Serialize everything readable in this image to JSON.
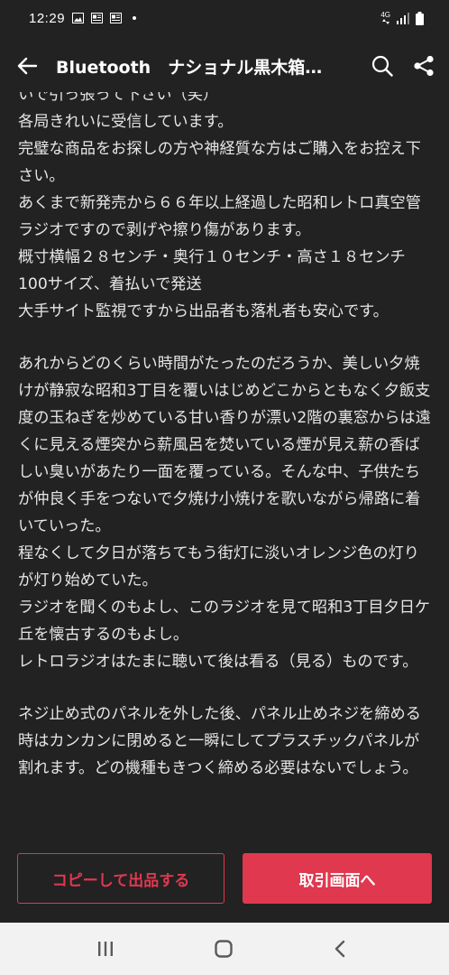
{
  "status_bar": {
    "time": "12:29",
    "network": "4G"
  },
  "header": {
    "title": "Bluetooth　ナショナル黒木箱…"
  },
  "description": {
    "paragraphs": [
      "いで引っ張って下さい（笑）",
      "各局きれいに受信しています。",
      "完璧な商品をお探しの方や神経質な方はご購入をお控え下さい。",
      "あくまで新発売から６６年以上経過した昭和レトロ真空管ラジオですので剥げや擦り傷があります。",
      "概寸横幅２８センチ・奥行１０センチ・高さ１８センチ",
      "100サイズ、着払いで発送",
      "大手サイト監視ですから出品者も落札者も安心です。",
      "",
      "あれからどのくらい時間がたったのだろうか、美しい夕焼けが静寂な昭和3丁目を覆いはじめどこからともなく夕飯支度の玉ねぎを炒めている甘い香りが漂い2階の裏窓からは遠くに見える煙突から薪風呂を焚いている煙が見え薪の香ばしい臭いがあたり一面を覆っている。そんな中、子供たちが仲良く手をつないで夕焼け小焼けを歌いながら帰路に着いていった。",
      "程なくして夕日が落ちてもう街灯に淡いオレンジ色の灯りが灯り始めていた。",
      "ラジオを聞くのもよし、このラジオを見て昭和3丁目夕日ケ丘を懐古するのもよし。",
      "レトロラジオはたまに聴いて後は看る（見る）ものです。",
      "",
      "ネジ止め式のパネルを外した後、パネル止めネジを締める時はカンカンに閉めると一瞬にしてプラスチックパネルが割れます。どの機種もきつく締める必要はないでしょう。"
    ]
  },
  "actions": {
    "copy_label": "コピーして出品する",
    "trade_label": "取引画面へ"
  },
  "colors": {
    "accent": "#e0384f",
    "background": "#222222",
    "nav_bar": "#f2f2f2"
  },
  "icons": {
    "back": "arrow-left-icon",
    "search": "search-icon",
    "share": "share-icon",
    "nav_recents": "recents-icon",
    "nav_home": "home-icon",
    "nav_back": "nav-back-icon"
  }
}
